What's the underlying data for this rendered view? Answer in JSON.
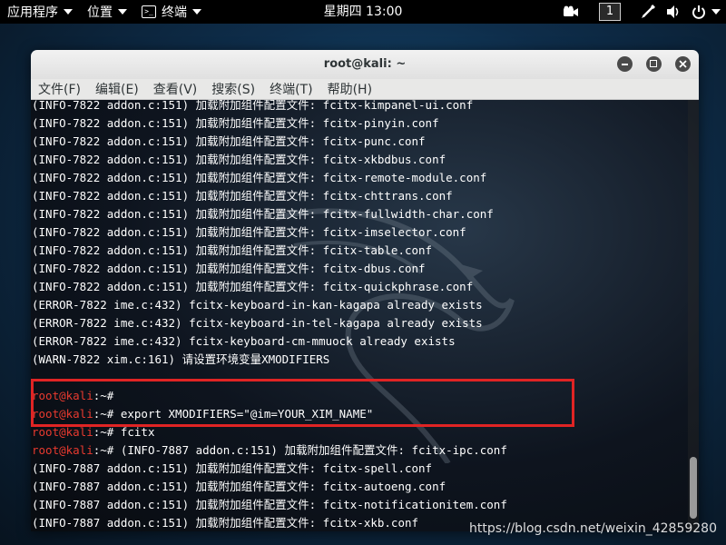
{
  "top_panel": {
    "applications_label": "应用程序",
    "places_label": "位置",
    "active_app_label": "终端",
    "clock": "星期四 13:00",
    "workspace_number": "1"
  },
  "window": {
    "title": "root@kali: ~",
    "menu": [
      "文件(F)",
      "编辑(E)",
      "查看(V)",
      "搜索(S)",
      "终端(T)",
      "帮助(H)"
    ]
  },
  "terminal": {
    "lines": [
      {
        "prompt": "",
        "text": "(INFO-7822 addon.c:151) 加载附加组件配置文件: fcitx-kimpanel-ui.conf"
      },
      {
        "prompt": "",
        "text": "(INFO-7822 addon.c:151) 加载附加组件配置文件: fcitx-pinyin.conf"
      },
      {
        "prompt": "",
        "text": "(INFO-7822 addon.c:151) 加载附加组件配置文件: fcitx-punc.conf"
      },
      {
        "prompt": "",
        "text": "(INFO-7822 addon.c:151) 加载附加组件配置文件: fcitx-xkbdbus.conf"
      },
      {
        "prompt": "",
        "text": "(INFO-7822 addon.c:151) 加载附加组件配置文件: fcitx-remote-module.conf"
      },
      {
        "prompt": "",
        "text": "(INFO-7822 addon.c:151) 加载附加组件配置文件: fcitx-chttrans.conf"
      },
      {
        "prompt": "",
        "text": "(INFO-7822 addon.c:151) 加载附加组件配置文件: fcitx-fullwidth-char.conf"
      },
      {
        "prompt": "",
        "text": "(INFO-7822 addon.c:151) 加载附加组件配置文件: fcitx-imselector.conf"
      },
      {
        "prompt": "",
        "text": "(INFO-7822 addon.c:151) 加载附加组件配置文件: fcitx-table.conf"
      },
      {
        "prompt": "",
        "text": "(INFO-7822 addon.c:151) 加载附加组件配置文件: fcitx-dbus.conf"
      },
      {
        "prompt": "",
        "text": "(INFO-7822 addon.c:151) 加载附加组件配置文件: fcitx-quickphrase.conf"
      },
      {
        "prompt": "",
        "text": "(ERROR-7822 ime.c:432) fcitx-keyboard-in-kan-kagapa already exists"
      },
      {
        "prompt": "",
        "text": "(ERROR-7822 ime.c:432) fcitx-keyboard-in-tel-kagapa already exists"
      },
      {
        "prompt": "",
        "text": "(ERROR-7822 ime.c:432) fcitx-keyboard-cm-mmuock already exists"
      },
      {
        "prompt": "",
        "text": "(WARN-7822 xim.c:161) 请设置环境变量XMODIFIERS"
      },
      {
        "prompt": "",
        "text": ""
      },
      {
        "prompt": "root@kali",
        "text": ":~# "
      },
      {
        "prompt": "root@kali",
        "text": ":~# export XMODIFIERS=\"@im=YOUR_XIM_NAME\""
      },
      {
        "prompt": "root@kali",
        "text": ":~# fcitx"
      },
      {
        "prompt": "root@kali",
        "text": ":~# (INFO-7887 addon.c:151) 加载附加组件配置文件: fcitx-ipc.conf"
      },
      {
        "prompt": "",
        "text": "(INFO-7887 addon.c:151) 加载附加组件配置文件: fcitx-spell.conf"
      },
      {
        "prompt": "",
        "text": "(INFO-7887 addon.c:151) 加载附加组件配置文件: fcitx-autoeng.conf"
      },
      {
        "prompt": "",
        "text": "(INFO-7887 addon.c:151) 加载附加组件配置文件: fcitx-notificationitem.conf"
      },
      {
        "prompt": "",
        "text": "(INFO-7887 addon.c:151) 加载附加组件配置文件: fcitx-xkb.conf"
      }
    ]
  },
  "watermark": "https://blog.csdn.net/weixin_42859280",
  "colors": {
    "prompt": "#e93a2f",
    "highlight_border": "#e02424",
    "panel_bg": "#000000"
  }
}
